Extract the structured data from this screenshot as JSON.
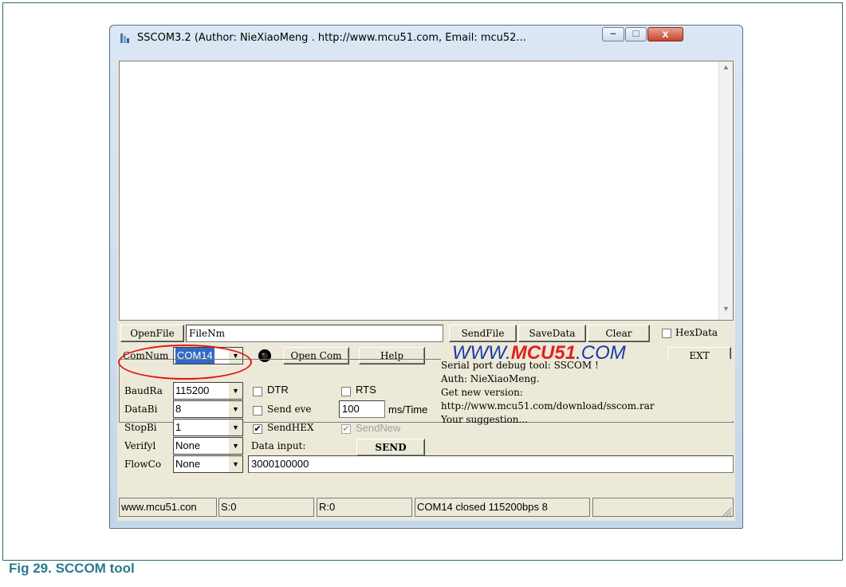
{
  "window": {
    "title": "SSCOM3.2 (Author: NieXiaoMeng . http://www.mcu51.com, Email: mcu52...",
    "minimize_glyph": "–",
    "maximize_glyph": "□",
    "close_glyph": "x"
  },
  "file_row": {
    "open_file_label": "OpenFile",
    "filename_value": "FileNm",
    "send_file_label": "SendFile",
    "save_data_label": "SaveData",
    "clear_label": "Clear",
    "hexdata_label": "HexData"
  },
  "com_row": {
    "comnum_label": "ComNum",
    "com_value": "COM14",
    "open_com_label": "Open Com",
    "help_label": "Help",
    "brand_prefix": "WWW.",
    "brand_mid": "MCU51",
    "brand_suffix": ".COM",
    "ext_label": "EXT"
  },
  "settings": {
    "baud_label": "BaudRa",
    "baud_value": "115200",
    "databits_label": "DataBi",
    "databits_value": "8",
    "stopbits_label": "StopBi",
    "stopbits_value": "1",
    "verify_label": "Verifyl",
    "verify_value": "None",
    "flow_label": "FlowCo",
    "flow_value": "None"
  },
  "options": {
    "dtr_label": "DTR",
    "rts_label": "RTS",
    "send_every_label": "Send eve",
    "interval_value": "100",
    "interval_unit": "ms/Time",
    "sendhex_label": "SendHEX",
    "sendhex_checked": true,
    "sendnew_label": "SendNew",
    "data_input_label": "Data input:",
    "send_label": "SEND",
    "data_input_value": "3000100000"
  },
  "info_lines": [
    "Serial port debug tool: SSCOM !",
    "Auth: NieXiaoMeng.",
    "Get new version:",
    "http://www.mcu51.com/download/sscom.rar",
    "Your suggestion..."
  ],
  "status": {
    "site": "www.mcu51.con",
    "sent": "S:0",
    "received": "R:0",
    "port_state": "COM14 closed 115200bps 8"
  },
  "caption": "Fig 29.   SCCOM tool",
  "colors": {
    "highlight": "#e01818",
    "brand_blue": "#1a3aa8",
    "brand_red": "#e02020",
    "caption": "#2a7a8c"
  }
}
